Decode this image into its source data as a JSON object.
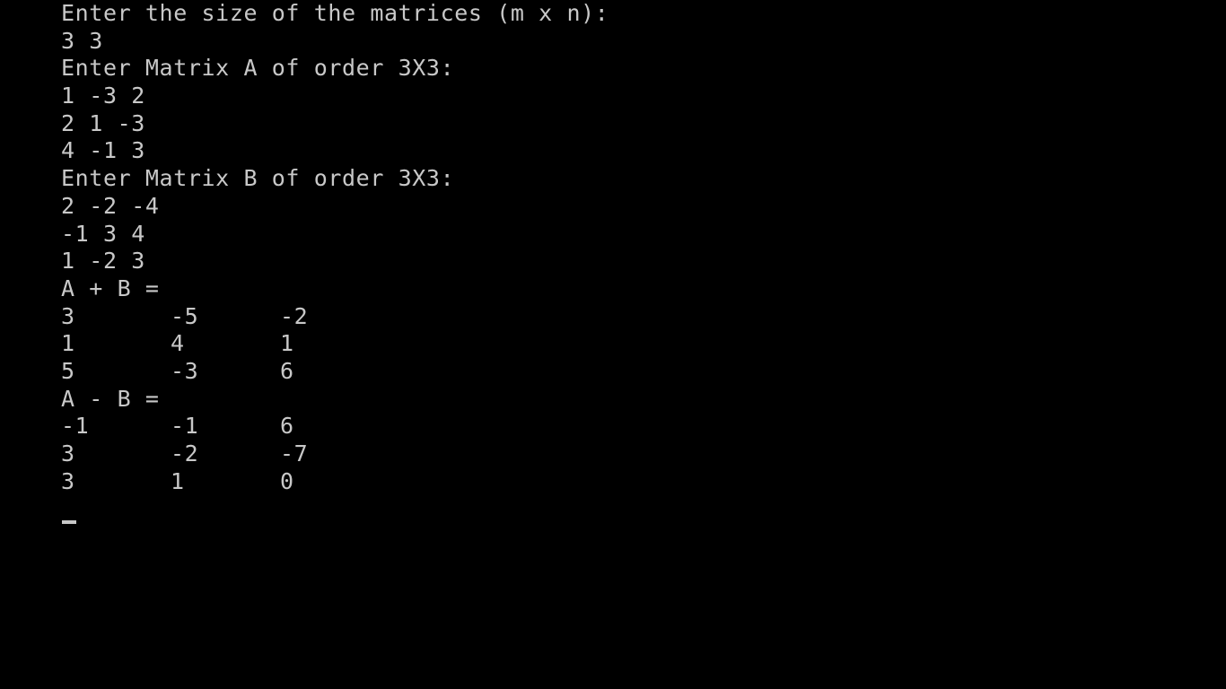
{
  "console": {
    "prompt_size": "Enter the size of the matrices (m x n):",
    "input_size": "3 3",
    "prompt_a": "Enter Matrix A of order 3X3:",
    "input_a": [
      "1 -3 2",
      "2 1 -3",
      "4 -1 3"
    ],
    "prompt_b": "Enter Matrix B of order 3X3:",
    "input_b": [
      "2 -2 -4",
      "-1 3 4",
      "1 -2 3"
    ],
    "sum_label": "A + B =",
    "sum_rows": [
      [
        "3",
        "-5",
        "-2"
      ],
      [
        "1",
        "4",
        "1"
      ],
      [
        "5",
        "-3",
        "6"
      ]
    ],
    "diff_label": "A - B =",
    "diff_rows": [
      [
        "-1",
        "-1",
        "6"
      ],
      [
        "3",
        "-2",
        "-7"
      ],
      [
        "3",
        "1",
        "0"
      ]
    ]
  },
  "colors": {
    "background": "#000000",
    "text": "#c8c8c8"
  }
}
